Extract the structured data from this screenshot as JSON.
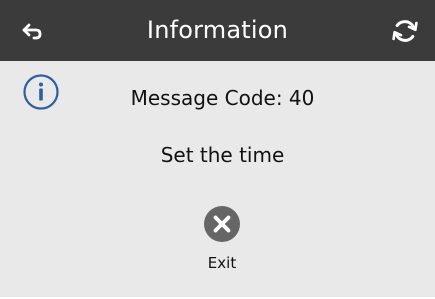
{
  "header": {
    "title": "Information",
    "back_icon": "back-arrow-icon",
    "refresh_icon": "refresh-icon"
  },
  "main": {
    "info_icon": "info-icon",
    "message_code": "Message Code: 40",
    "message": "Set the time",
    "exit": {
      "icon": "close-icon",
      "label": "Exit"
    }
  },
  "colors": {
    "header_bg": "#3b3b3b",
    "header_text": "#ffffff",
    "body_bg": "#e9e9e9",
    "info_accent": "#2f5f9f",
    "exit_icon": "#666666"
  }
}
